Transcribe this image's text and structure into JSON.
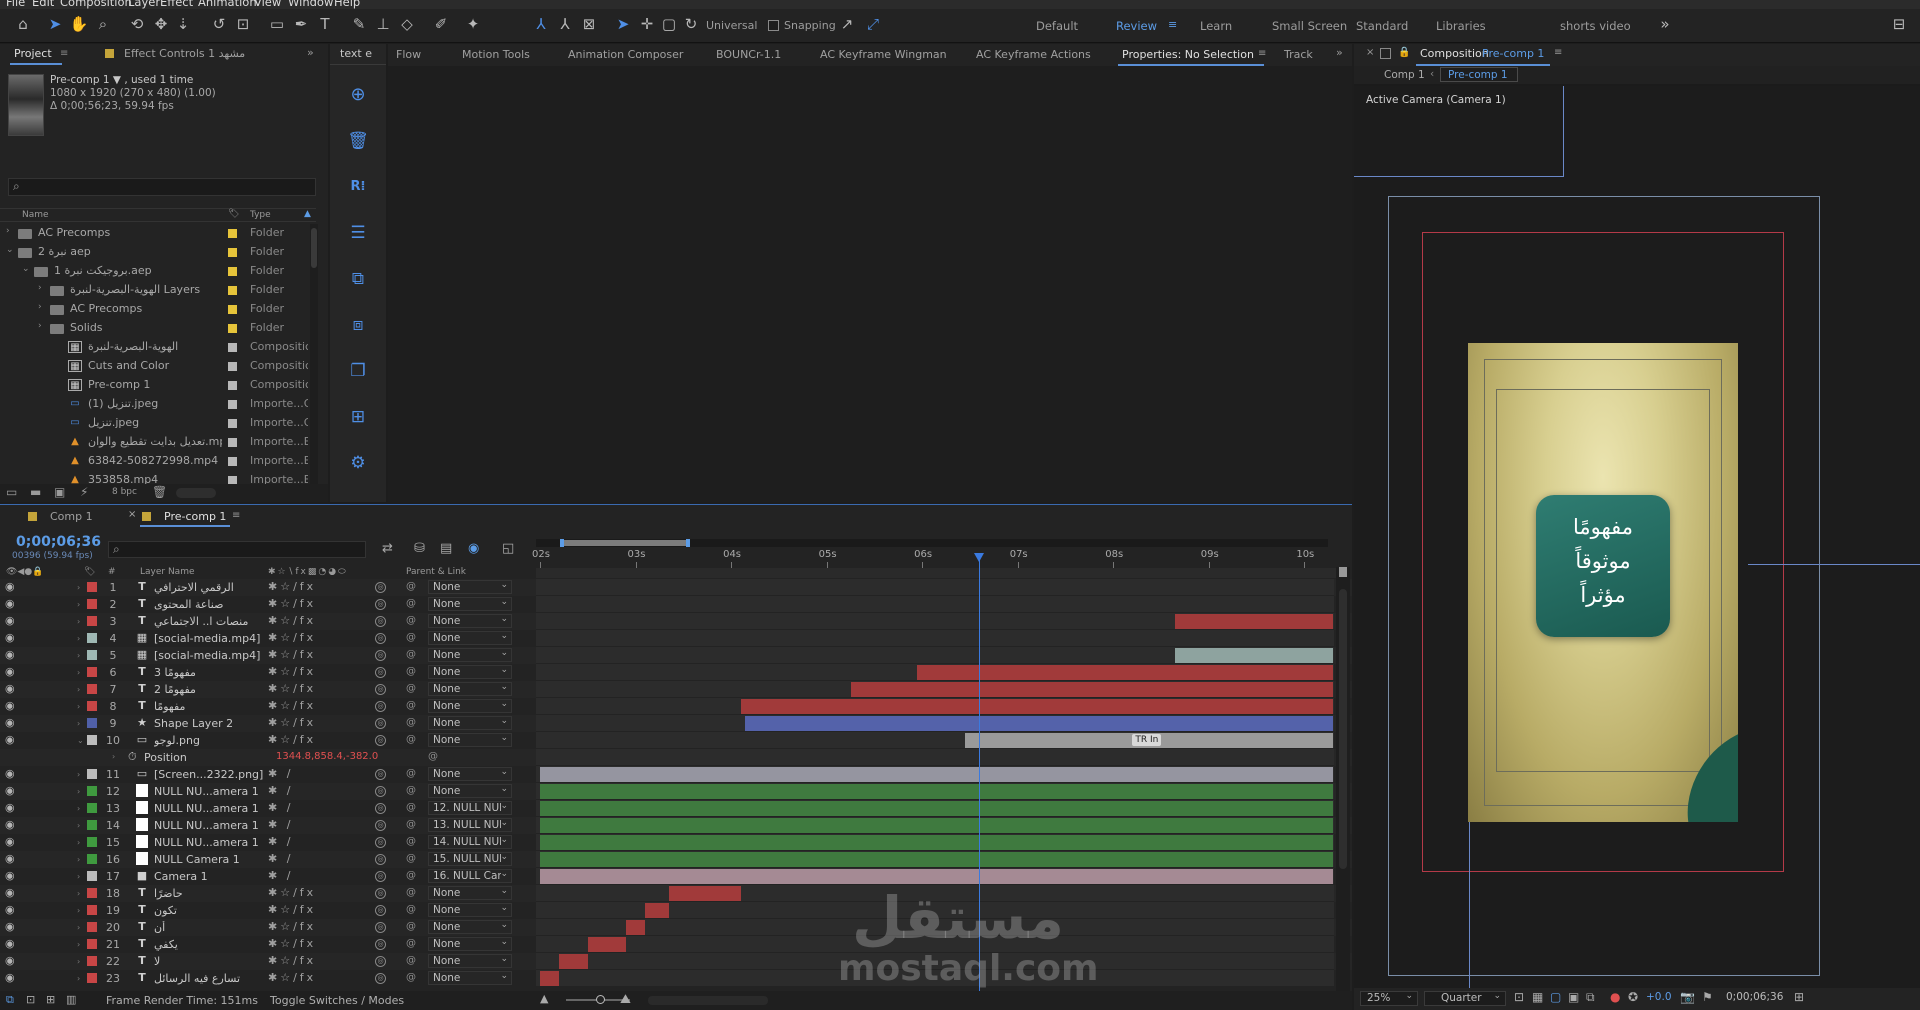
{
  "menu": [
    "File",
    "Edit",
    "Composition",
    "Layer",
    "Effect",
    "Animation",
    "View",
    "Window",
    "Help"
  ],
  "toolbar": {
    "universal": "Universal",
    "snapping": "Snapping",
    "workspaces": [
      "Default",
      "Review",
      "Learn",
      "Small Screen",
      "Standard",
      "Libraries",
      "shorts video"
    ],
    "active_workspace": "Review"
  },
  "project_panel": {
    "tab_project": "Project",
    "tab_effect_controls": "Effect Controls 1 مشهد",
    "item_name": "Pre-comp 1 ▼ , used 1 time",
    "item_dims": "1080 x 1920  (270 x 480) (1.00)",
    "item_duration": "Δ 0;00;56;23, 59.94 fps",
    "search_icon": "⌕",
    "col_name": "Name",
    "col_type": "Type",
    "items": [
      {
        "name": "AC Precomps",
        "type": "Folder",
        "kind": "folder",
        "indent": 0,
        "arrow": "›",
        "color": "#e6c43a"
      },
      {
        "name": "نبرة 2 aep",
        "type": "Folder",
        "kind": "folder",
        "indent": 0,
        "arrow": "⌄",
        "color": "#e6c43a"
      },
      {
        "name": "بروجيكت نبرة 1.aep",
        "type": "Folder",
        "kind": "folder",
        "indent": 1,
        "arrow": "⌄",
        "color": "#e6c43a"
      },
      {
        "name": "الهوية-البصرية-لنبرة Layers",
        "type": "Folder",
        "kind": "folder",
        "indent": 2,
        "arrow": "›",
        "color": "#e6c43a"
      },
      {
        "name": "AC Precomps",
        "type": "Folder",
        "kind": "folder",
        "indent": 2,
        "arrow": "›",
        "color": "#e6c43a"
      },
      {
        "name": "Solids",
        "type": "Folder",
        "kind": "folder",
        "indent": 2,
        "arrow": "›",
        "color": "#e6c43a"
      },
      {
        "name": "الهوية-البصرية-لنبرة",
        "type": "Compositic",
        "kind": "comp",
        "indent": 2,
        "arrow": "",
        "color": "#b8b8b8"
      },
      {
        "name": "Cuts and Color",
        "type": "Compositic",
        "kind": "comp",
        "indent": 2,
        "arrow": "",
        "color": "#b8b8b8"
      },
      {
        "name": "Pre-comp 1",
        "type": "Compositic",
        "kind": "comp",
        "indent": 2,
        "arrow": "",
        "color": "#b8b8b8"
      },
      {
        "name": "تنزيل (1).jpeg",
        "type": "Importe...G",
        "kind": "image",
        "indent": 2,
        "arrow": "",
        "color": "#b8b8b8"
      },
      {
        "name": "تنزيل.jpeg",
        "type": "Importe...G",
        "kind": "image",
        "indent": 2,
        "arrow": "",
        "color": "#b8b8b8"
      },
      {
        "name": "تعديل بدايت تقطيع والوان.mp4",
        "type": "Importe...E",
        "kind": "video",
        "indent": 2,
        "arrow": "",
        "color": "#b8b8b8"
      },
      {
        "name": "63842-508272998.mp4",
        "type": "Importe...E",
        "kind": "video",
        "indent": 2,
        "arrow": "",
        "color": "#b8b8b8"
      },
      {
        "name": "353858.mp4",
        "type": "Importe...E",
        "kind": "video",
        "indent": 2,
        "arrow": "",
        "color": "#b8b8b8"
      }
    ],
    "bpc": "8 bpc"
  },
  "tabs_row": [
    "text e",
    "Flow",
    "Motion Tools",
    "Animation Composer",
    "BOUNCr-1.1",
    "AC Keyframe Wingman",
    "AC Keyframe Actions",
    "Properties: No Selection",
    "Track"
  ],
  "composition": {
    "title_prefix": "Composition",
    "title_name": "Pre-comp 1",
    "crumbs": [
      "Comp 1",
      "Pre-comp 1"
    ],
    "camera_label": "Active Camera (Camera 1)",
    "card_text": [
      "مفهومًا",
      "موثوقاً",
      "مؤثراً"
    ],
    "zoom": "25%",
    "resolution": "Quarter",
    "exposure": "+0.0",
    "timecode": "0;00;06;36"
  },
  "timeline": {
    "tabs": [
      "Comp 1",
      "Pre-comp 1"
    ],
    "timecode": "0;00;06;36",
    "fps": "00396 (59.94 fps)",
    "search_icon": "⌕",
    "col_layer": "Layer Name",
    "col_parent": "Parent & Link",
    "ticks": [
      "02s",
      "03s",
      "04s",
      "05s",
      "06s",
      "07s",
      "08s",
      "09s",
      "10s"
    ],
    "playhead_seconds": 6.6,
    "view_start_seconds": 2.0,
    "view_end_seconds": 10.3,
    "layers": [
      {
        "num": "1",
        "type": "T",
        "name": "الرقمي الاحترافي",
        "parent": "None",
        "label": "#c84646",
        "bar": null
      },
      {
        "num": "2",
        "type": "T",
        "name": "صناعة المحتوى",
        "parent": "None",
        "label": "#c84646",
        "bar": null
      },
      {
        "num": "3",
        "type": "T",
        "name": "منصات ا.. الاجتماعي",
        "parent": "None",
        "label": "#c84646",
        "bar": [
          8.65,
          10.3
        ],
        "barColor": "#a13a3a"
      },
      {
        "num": "4",
        "type": "V",
        "name": "[social-media.mp4]",
        "parent": "None",
        "label": "#9fb8b4",
        "bar": null
      },
      {
        "num": "5",
        "type": "V",
        "name": "[social-media.mp4]",
        "parent": "None",
        "label": "#9fb8b4",
        "bar": [
          8.65,
          10.3
        ],
        "barColor": "#8ea39f"
      },
      {
        "num": "6",
        "type": "T",
        "name": "مفهومًا 3",
        "parent": "None",
        "label": "#c84646",
        "bar": [
          5.95,
          10.3
        ],
        "barColor": "#a13a3a"
      },
      {
        "num": "7",
        "type": "T",
        "name": "مفهومًا 2",
        "parent": "None",
        "label": "#c84646",
        "bar": [
          5.25,
          10.3
        ],
        "barColor": "#a13a3a"
      },
      {
        "num": "8",
        "type": "T",
        "name": "مفهومًا",
        "parent": "None",
        "label": "#c84646",
        "bar": [
          4.1,
          10.3
        ],
        "barColor": "#a13a3a"
      },
      {
        "num": "9",
        "type": "S",
        "name": "Shape Layer 2",
        "parent": "None",
        "label": "#5060a8",
        "bar": [
          4.15,
          10.3
        ],
        "barColor": "#5462aa"
      },
      {
        "num": "10",
        "type": "I",
        "name": "لوجو.png",
        "parent": "None",
        "label": "#bcbcbc",
        "bar": [
          6.45,
          10.3
        ],
        "barColor": "#9a9a9a",
        "open": true,
        "marker": "TR In"
      },
      {
        "num": "",
        "type": "P",
        "name": "Position",
        "parent": "",
        "value": "1344.8,858.4,-382.0",
        "label": "",
        "bar": null
      },
      {
        "num": "11",
        "type": "I",
        "name": "[Screen...2322.png]",
        "parent": "None",
        "label": "#bcbcbc",
        "bar": [
          2.0,
          10.3
        ],
        "barColor": "#9595a0"
      },
      {
        "num": "12",
        "type": "N",
        "name": "NULL NU...amera 1",
        "parent": "None",
        "label": "#3f9a3f",
        "bar": [
          2.0,
          10.3
        ],
        "barColor": "#3f7a3f"
      },
      {
        "num": "13",
        "type": "N",
        "name": "NULL NU...amera 1",
        "parent": "12. NULL NUI",
        "label": "#3f9a3f",
        "bar": [
          2.0,
          10.3
        ],
        "barColor": "#3f7a3f"
      },
      {
        "num": "14",
        "type": "N",
        "name": "NULL NU...amera 1",
        "parent": "13. NULL NUI",
        "label": "#3f9a3f",
        "bar": [
          2.0,
          10.3
        ],
        "barColor": "#3f7a3f"
      },
      {
        "num": "15",
        "type": "N",
        "name": "NULL NU...amera 1",
        "parent": "14. NULL NUI",
        "label": "#3f9a3f",
        "bar": [
          2.0,
          10.3
        ],
        "barColor": "#3f7a3f"
      },
      {
        "num": "16",
        "type": "N",
        "name": "NULL Camera 1",
        "parent": "15. NULL NUI",
        "label": "#3f9a3f",
        "bar": [
          2.0,
          10.3
        ],
        "barColor": "#3f7a3f"
      },
      {
        "num": "17",
        "type": "C",
        "name": "Camera 1",
        "parent": "16. NULL Can",
        "label": "#bcbcbc",
        "bar": [
          2.0,
          10.3
        ],
        "barColor": "#a58a94"
      },
      {
        "num": "18",
        "type": "T",
        "name": "حاضرًا",
        "parent": "None",
        "label": "#c84646",
        "bar": [
          3.35,
          4.1
        ],
        "barColor": "#a13a3a"
      },
      {
        "num": "19",
        "type": "T",
        "name": "تكون",
        "parent": "None",
        "label": "#c84646",
        "bar": [
          3.1,
          3.35
        ],
        "barColor": "#a13a3a"
      },
      {
        "num": "20",
        "type": "T",
        "name": "أن",
        "parent": "None",
        "label": "#c84646",
        "bar": [
          2.9,
          3.1
        ],
        "barColor": "#a13a3a"
      },
      {
        "num": "21",
        "type": "T",
        "name": "يكفي",
        "parent": "None",
        "label": "#c84646",
        "bar": [
          2.5,
          2.9
        ],
        "barColor": "#a13a3a"
      },
      {
        "num": "22",
        "type": "T",
        "name": "لا",
        "parent": "None",
        "label": "#c84646",
        "bar": [
          2.2,
          2.5
        ],
        "barColor": "#a13a3a"
      },
      {
        "num": "23",
        "type": "T",
        "name": "تسارع فيه الرسائل",
        "parent": "None",
        "label": "#c84646",
        "bar": [
          2.0,
          2.2
        ],
        "barColor": "#a13a3a"
      }
    ],
    "frame_render": "Frame Render Time:  151ms",
    "toggle": "Toggle Switches / Modes"
  },
  "watermark": {
    "arabic": "مستقل",
    "latin": "mostaql.com"
  }
}
